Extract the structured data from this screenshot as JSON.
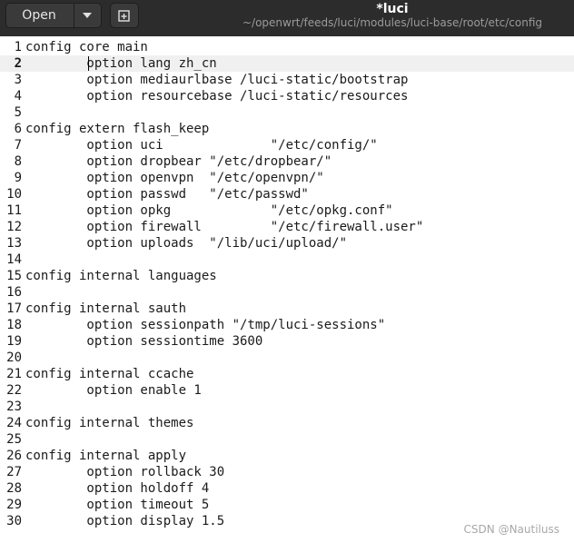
{
  "toolbar": {
    "open_label": "Open",
    "title": "*luci",
    "subtitle": "~/openwrt/feeds/luci/modules/luci-base/root/etc/config"
  },
  "editor": {
    "current_line": 2,
    "lines": [
      {
        "num": "1",
        "text": "config core main"
      },
      {
        "num": "2",
        "text": "        option lang zh_cn"
      },
      {
        "num": "3",
        "text": "        option mediaurlbase /luci-static/bootstrap"
      },
      {
        "num": "4",
        "text": "        option resourcebase /luci-static/resources"
      },
      {
        "num": "5",
        "text": ""
      },
      {
        "num": "6",
        "text": "config extern flash_keep"
      },
      {
        "num": "7",
        "text": "        option uci              \"/etc/config/\""
      },
      {
        "num": "8",
        "text": "        option dropbear \"/etc/dropbear/\""
      },
      {
        "num": "9",
        "text": "        option openvpn  \"/etc/openvpn/\""
      },
      {
        "num": "10",
        "text": "        option passwd   \"/etc/passwd\""
      },
      {
        "num": "11",
        "text": "        option opkg             \"/etc/opkg.conf\""
      },
      {
        "num": "12",
        "text": "        option firewall         \"/etc/firewall.user\""
      },
      {
        "num": "13",
        "text": "        option uploads  \"/lib/uci/upload/\""
      },
      {
        "num": "14",
        "text": ""
      },
      {
        "num": "15",
        "text": "config internal languages"
      },
      {
        "num": "16",
        "text": ""
      },
      {
        "num": "17",
        "text": "config internal sauth"
      },
      {
        "num": "18",
        "text": "        option sessionpath \"/tmp/luci-sessions\""
      },
      {
        "num": "19",
        "text": "        option sessiontime 3600"
      },
      {
        "num": "20",
        "text": ""
      },
      {
        "num": "21",
        "text": "config internal ccache"
      },
      {
        "num": "22",
        "text": "        option enable 1"
      },
      {
        "num": "23",
        "text": ""
      },
      {
        "num": "24",
        "text": "config internal themes"
      },
      {
        "num": "25",
        "text": ""
      },
      {
        "num": "26",
        "text": "config internal apply"
      },
      {
        "num": "27",
        "text": "        option rollback 30"
      },
      {
        "num": "28",
        "text": "        option holdoff 4"
      },
      {
        "num": "29",
        "text": "        option timeout 5"
      },
      {
        "num": "30",
        "text": "        option display 1.5"
      }
    ]
  },
  "watermark": "CSDN @Nautiluss"
}
